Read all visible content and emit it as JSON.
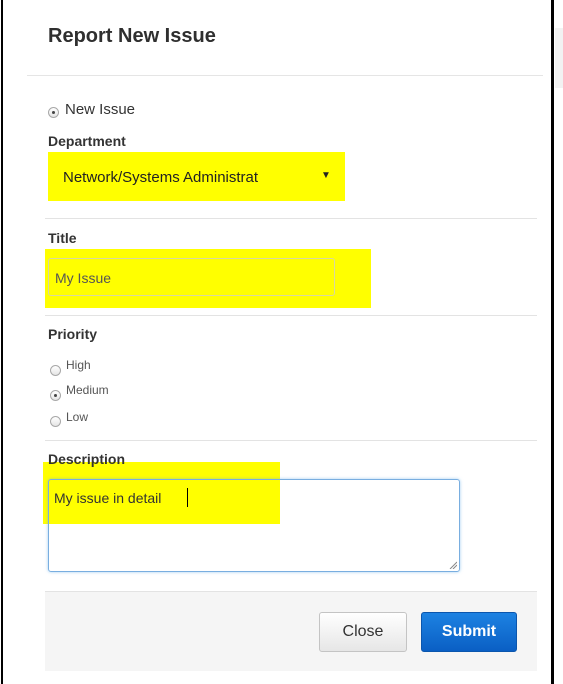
{
  "dialog": {
    "title": "Report New Issue"
  },
  "issue_type": {
    "label": "New Issue",
    "selected": true
  },
  "department": {
    "label": "Department",
    "selected_value": "Network/Systems Administrat"
  },
  "title_field": {
    "label": "Title",
    "value": "My Issue"
  },
  "priority": {
    "label": "Priority",
    "options": [
      {
        "label": "High",
        "selected": false
      },
      {
        "label": "Medium",
        "selected": true
      },
      {
        "label": "Low",
        "selected": false
      }
    ]
  },
  "description": {
    "label": "Description",
    "value": "My issue in detail"
  },
  "footer": {
    "close_label": "Close",
    "submit_label": "Submit"
  },
  "colors": {
    "highlight": "#ffff00",
    "submit_button": "#0a5fc4",
    "focus_border": "#79aee0"
  }
}
